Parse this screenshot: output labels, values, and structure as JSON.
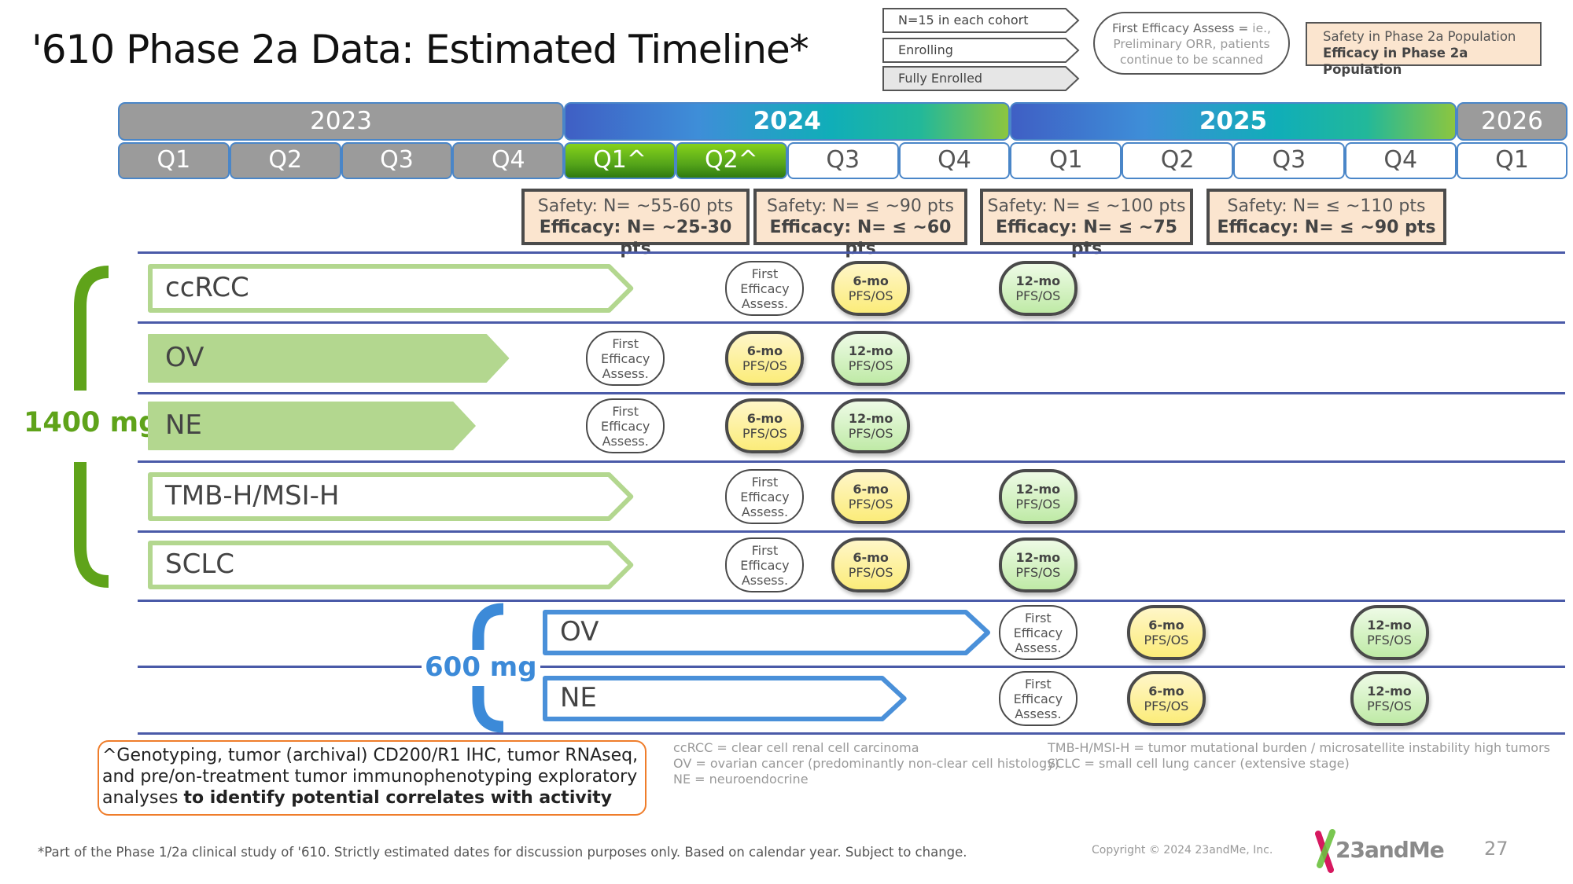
{
  "title": "'610 Phase 2a Data: Estimated Timeline*",
  "legend": {
    "chevrons": [
      {
        "label": "N=15 in each cohort",
        "fill": "#ffffff"
      },
      {
        "label": "Enrolling",
        "fill": "#ffffff"
      },
      {
        "label": "Fully Enrolled",
        "fill": "#e6e6e6"
      }
    ],
    "ellipse_main": "First Efficacy Assess = ",
    "ellipse_faint": "ie., Preliminary ORR, patients continue to be scanned",
    "box_line1": "Safety in Phase 2a Population",
    "box_line2": "Efficacy in Phase 2a Population"
  },
  "timeline": {
    "years": [
      {
        "label": "2023",
        "quarters": 4,
        "style": "grey"
      },
      {
        "label": "2024",
        "quarters": 4,
        "style": "grad"
      },
      {
        "label": "2025",
        "quarters": 4,
        "style": "grad"
      },
      {
        "label": "2026",
        "quarters": 1,
        "style": "grey"
      }
    ],
    "quarters": [
      {
        "label": "Q1",
        "style": "grey"
      },
      {
        "label": "Q2",
        "style": "grey"
      },
      {
        "label": "Q3",
        "style": "grey"
      },
      {
        "label": "Q4",
        "style": "grey"
      },
      {
        "label": "Q1^",
        "style": "green"
      },
      {
        "label": "Q2^",
        "style": "green"
      },
      {
        "label": "Q3",
        "style": "white"
      },
      {
        "label": "Q4",
        "style": "white"
      },
      {
        "label": "Q1",
        "style": "white"
      },
      {
        "label": "Q2",
        "style": "white"
      },
      {
        "label": "Q3",
        "style": "white"
      },
      {
        "label": "Q4",
        "style": "white"
      },
      {
        "label": "Q1",
        "style": "white"
      }
    ]
  },
  "population_boxes": [
    {
      "safety": "Safety: N= ~55-60 pts",
      "efficacy": "Efficacy: N= ~25-30 pts",
      "quarter_start": 4,
      "quarter_end": 6
    },
    {
      "safety": "Safety: N= ≤ ~90 pts",
      "efficacy": "Efficacy: N= ≤ ~60 pts",
      "quarter_start": 6,
      "quarter_end": 8
    },
    {
      "safety": "Safety: N= ≤ ~100 pts",
      "efficacy": "Efficacy: N= ≤ ~75 pts",
      "quarter_start": 8,
      "quarter_end": 10
    },
    {
      "safety": "Safety: N= ≤ ~110 pts",
      "efficacy": "Efficacy: N= ≤ ~90 pts",
      "quarter_start": 10,
      "quarter_end": 12
    }
  ],
  "doses": [
    {
      "label": "1400 mg",
      "color": "#5fa31a"
    },
    {
      "label": "600 mg",
      "color": "#3c8ad8"
    }
  ],
  "milestone_text": {
    "fe": [
      "First",
      "Efficacy",
      "Assess."
    ],
    "six_top": "6-mo",
    "twelve_top": "12-mo",
    "bottom": "PFS/OS"
  },
  "cohorts": [
    {
      "label": "ccRCC",
      "dose": "1400 mg",
      "status": "enrolling",
      "end_quarter": 4.6,
      "milestones": [
        {
          "type": "fe",
          "quarter": 5.8
        },
        {
          "type": "six",
          "quarter": 6.75
        },
        {
          "type": "twelve",
          "quarter": 8.25
        }
      ]
    },
    {
      "label": "OV",
      "dose": "1400 mg",
      "status": "fully-enrolled",
      "end_quarter": 3.5,
      "milestones": [
        {
          "type": "fe",
          "quarter": 4.55
        },
        {
          "type": "six",
          "quarter": 5.8
        },
        {
          "type": "twelve",
          "quarter": 6.75
        }
      ]
    },
    {
      "label": "NE",
      "dose": "1400 mg",
      "status": "fully-enrolled",
      "end_quarter": 3.2,
      "milestones": [
        {
          "type": "fe",
          "quarter": 4.55
        },
        {
          "type": "six",
          "quarter": 5.8
        },
        {
          "type": "twelve",
          "quarter": 6.75
        }
      ]
    },
    {
      "label": "TMB-H/MSI-H",
      "dose": "1400 mg",
      "status": "enrolling",
      "end_quarter": 4.6,
      "milestones": [
        {
          "type": "fe",
          "quarter": 5.8
        },
        {
          "type": "six",
          "quarter": 6.75
        },
        {
          "type": "twelve",
          "quarter": 8.25
        }
      ]
    },
    {
      "label": "SCLC",
      "dose": "1400 mg",
      "status": "enrolling",
      "end_quarter": 4.6,
      "milestones": [
        {
          "type": "fe",
          "quarter": 5.8
        },
        {
          "type": "six",
          "quarter": 6.75
        },
        {
          "type": "twelve",
          "quarter": 8.25
        }
      ]
    },
    {
      "label": "OV",
      "dose": "600 mg",
      "status": "enrolling-600",
      "end_quarter": 7.8,
      "milestones": [
        {
          "type": "fe",
          "quarter": 8.25
        },
        {
          "type": "six",
          "quarter": 9.4
        },
        {
          "type": "twelve",
          "quarter": 11.4
        }
      ]
    },
    {
      "label": "NE",
      "dose": "600 mg",
      "status": "enrolling-600",
      "end_quarter": 7.05,
      "milestones": [
        {
          "type": "fe",
          "quarter": 8.25
        },
        {
          "type": "six",
          "quarter": 9.4
        },
        {
          "type": "twelve",
          "quarter": 11.4
        }
      ]
    }
  ],
  "colors": {
    "enrolling_border": "#b3d78f",
    "fully_enrolled_fill": "#b3d78f",
    "enrolling_600_border": "#4a90d9",
    "divider": "#4a5aa8",
    "note_border": "#ef7d2b"
  },
  "note": {
    "plain": "^Genotyping, tumor (archival) CD200/R1 IHC, tumor RNAseq, and pre/on-treatment tumor immunophenotyping exploratory analyses ",
    "bold": "to identify potential correlates with activity"
  },
  "abbreviations": {
    "col1": [
      "ccRCC = clear cell renal cell carcinoma",
      "OV = ovarian cancer (predominantly non-clear cell histology)",
      "NE = neuroendocrine"
    ],
    "col2": [
      "TMB-H/MSI-H = tumor mutational burden / microsatellite instability high tumors",
      "SCLC = small cell lung cancer (extensive stage)"
    ]
  },
  "footer": {
    "footnote": "*Part of the Phase 1/2a clinical study of '610. Strictly estimated dates for discussion purposes only. Based on calendar year. Subject to change.",
    "copyright": "Copyright © 2024 23andMe, Inc.",
    "logo_text": "23andMe",
    "page_number": "27"
  }
}
